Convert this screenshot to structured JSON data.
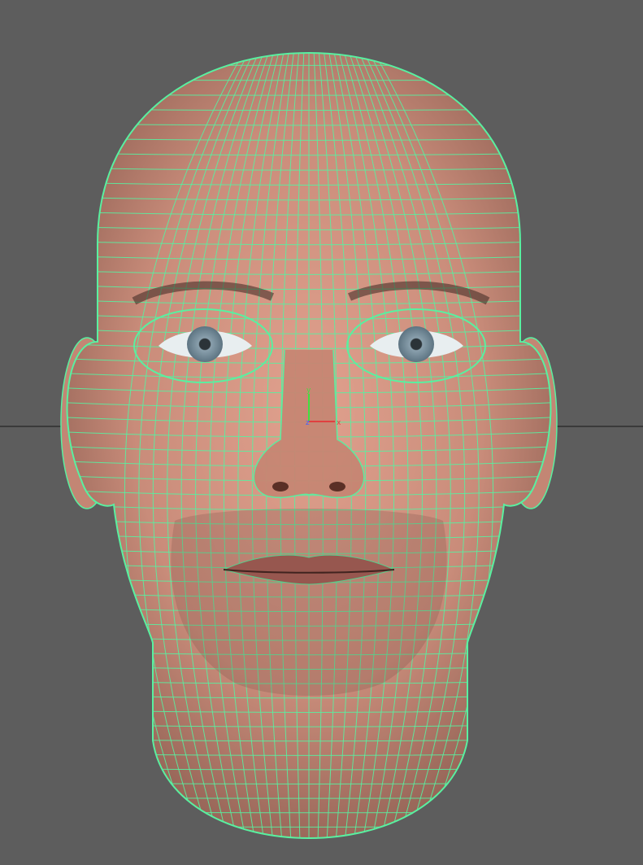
{
  "viewport": {
    "view": "front",
    "background_color": "#5d5d5d",
    "horizon_line_color": "#3a3a3a"
  },
  "model": {
    "name": "head-mesh",
    "display_mode": "wireframe-on-shaded",
    "skin_color": "#c98c7a",
    "wireframe_color": "#59f0a0",
    "iris_color": "#7e95a3"
  },
  "axis_gizmo": {
    "x_axis_color": "#e04040",
    "y_axis_color": "#40e040",
    "z_axis_color": "#4060ff",
    "labels": [
      "y",
      "z",
      "x"
    ]
  }
}
